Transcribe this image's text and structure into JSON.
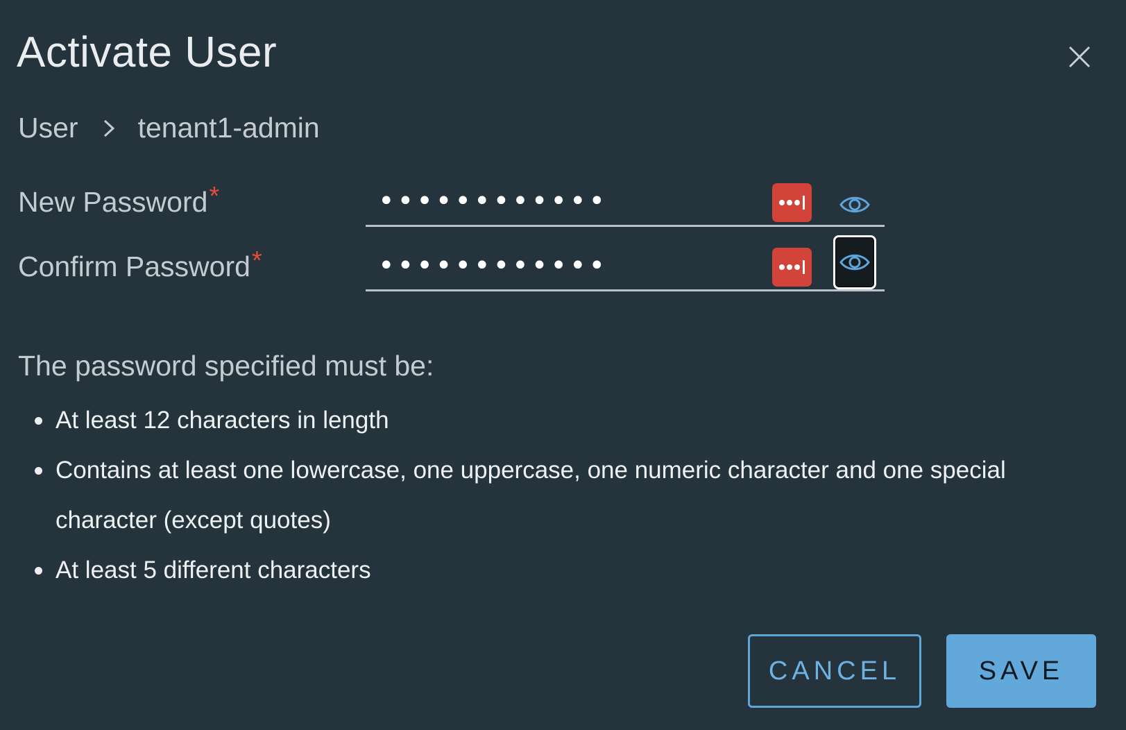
{
  "dialog": {
    "title": "Activate User",
    "breadcrumb": {
      "parent": "User",
      "current": "tenant1-admin"
    }
  },
  "form": {
    "new_password": {
      "label": "New Password",
      "required_marker": "*",
      "value": "............"
    },
    "confirm_password": {
      "label": "Confirm Password",
      "required_marker": "*",
      "value": "............"
    }
  },
  "help": {
    "heading": "The password specified must be:",
    "rules": [
      "At least 12 characters in length",
      "Contains at least one lowercase, one uppercase, one numeric character and one special character (except quotes)",
      "At least 5 different characters"
    ]
  },
  "actions": {
    "cancel_label": "CANCEL",
    "save_label": "SAVE"
  },
  "icons": {
    "close": "close-icon",
    "breadcrumb_separator": "chevron-right-icon",
    "password_manager": "lastpass-icon",
    "show_password": "eye-icon"
  },
  "colors": {
    "background": "#25333d",
    "accent": "#62a8db",
    "required": "#e34d3a",
    "password_manager": "#d2433a"
  }
}
